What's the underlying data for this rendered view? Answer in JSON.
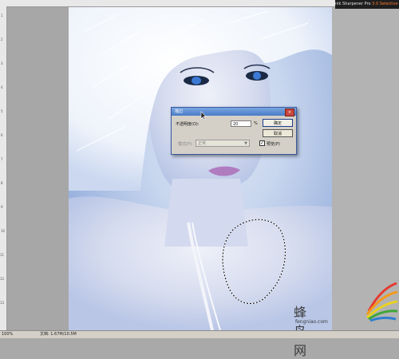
{
  "plugin": {
    "name": "nik Sharpener Pro",
    "version": "3.0 Selective"
  },
  "ruler": {
    "ticks": [
      "1",
      "2",
      "3",
      "4",
      "5",
      "6",
      "7",
      "8",
      "9",
      "10",
      "11",
      "12",
      "13"
    ]
  },
  "status": {
    "zoom": "100%",
    "doc": "文档: 1.67M/10.5M"
  },
  "dialog": {
    "title": "描边",
    "close_label": "×",
    "opacity_label": "不透明度(O):",
    "opacity_value": "20",
    "percent": "%",
    "ok": "确定",
    "cancel": "取消",
    "mode_label": "模式(P):",
    "mode_value": "正常",
    "preview_label": "预览(P)",
    "preview_checked": true
  },
  "watermark": {
    "brand": "蜂鸟网",
    "url": "fengniao.com"
  }
}
